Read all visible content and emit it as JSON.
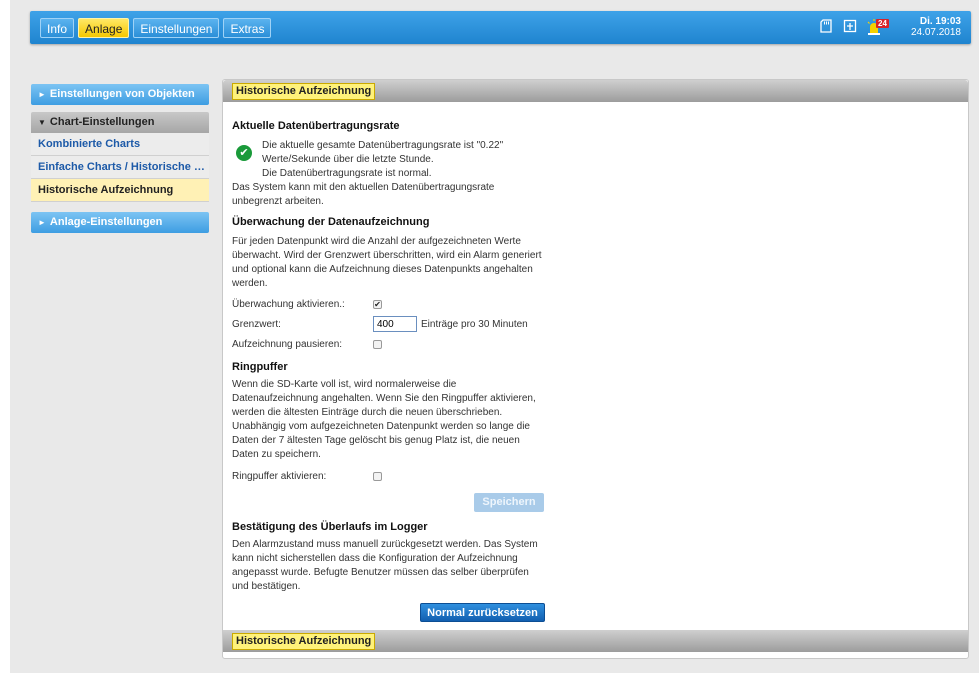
{
  "topbar": {
    "tabs": [
      {
        "label": "Info",
        "active": false
      },
      {
        "label": "Anlage",
        "active": true
      },
      {
        "label": "Einstellungen",
        "active": false
      },
      {
        "label": "Extras",
        "active": false
      }
    ],
    "alarm_count": "24",
    "day_time": "Di. 19:03",
    "date": "24.07.2018"
  },
  "sidebar": {
    "group1": "Einstellungen von Objekten",
    "group2": "Chart-Einstellungen",
    "group2_items": [
      "Kombinierte Charts",
      "Einfache Charts / Historische D...",
      "Historische Aufzeichnung"
    ],
    "group3": "Anlage-Einstellungen"
  },
  "panel": {
    "title": "Historische Aufzeichnung",
    "footer_title": "Historische Aufzeichnung"
  },
  "rate": {
    "heading": "Aktuelle Datenübertragungsrate",
    "line1": "Die aktuelle gesamte Datenübertragungsrate ist \"0.22\"",
    "line2": "Werte/Sekunde über die letzte Stunde.",
    "status": "Die Datenübertragungsrate ist normal.",
    "info1": "Das System kann mit den aktuellen Datenübertragungsrate",
    "info2": "unbegrenzt arbeiten."
  },
  "monitor": {
    "heading": "Überwachung der Datenaufzeichnung",
    "desc1": "Für jeden Datenpunkt wird die Anzahl der aufgezeichneten Werte",
    "desc2": "überwacht. Wird der Grenzwert überschritten, wird ein Alarm generiert",
    "desc3": "und optional kann die Aufzeichnung dieses Datenpunkts angehalten",
    "desc4": "werden.",
    "enable_label": "Überwachung aktivieren.:",
    "enable_checked": true,
    "limit_label": "Grenzwert:",
    "limit_value": "400",
    "limit_unit": "Einträge pro 30 Minuten",
    "pause_label": "Aufzeichnung pausieren:",
    "pause_checked": false
  },
  "ring": {
    "heading": "Ringpuffer",
    "d1": "Wenn die SD-Karte voll ist, wird normalerweise die",
    "d2": "Datenaufzeichnung angehalten. Wenn Sie den Ringpuffer aktivieren,",
    "d3": "werden die ältesten Einträge durch die neuen überschrieben.",
    "d4": "Unabhängig vom aufgezeichneten Datenpunkt werden so lange die",
    "d5": "Daten der 7 ältesten Tage gelöscht bis genug Platz ist, die neuen",
    "d6": "Daten zu speichern.",
    "enable_label": "Ringpuffer aktivieren:",
    "enable_checked": false,
    "save_label": "Speichern"
  },
  "overflow": {
    "heading": "Bestätigung des Überlaufs im Logger",
    "d1": "Den Alarmzustand muss manuell zurückgesetzt werden. Das System",
    "d2": "kann nicht sicherstellen dass die Konfiguration der Aufzeichnung",
    "d3": "angepasst wurde. Befugte Benutzer müssen das selber überprüfen",
    "d4": "und bestätigen.",
    "reset_label": "Normal zurücksetzen"
  },
  "colors": {
    "accent": "#2a92dc",
    "active_tab": "#ffe033",
    "ok": "#1a9a3a",
    "alarm": "#d8232a"
  }
}
